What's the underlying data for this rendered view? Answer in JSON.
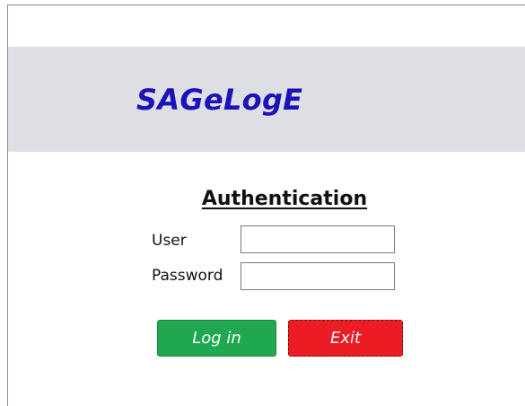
{
  "app": {
    "brand": "SAGeLogE"
  },
  "auth": {
    "title": "Authentication",
    "user_label": "User",
    "user_value": "",
    "password_label": "Password",
    "password_value": ""
  },
  "buttons": {
    "login_label": "Log in",
    "exit_label": "Exit"
  },
  "colors": {
    "brand": "#1b12b8",
    "banner_bg": "#dedfe4",
    "login_bg": "#1fa84f",
    "exit_bg": "#ec1c24"
  }
}
